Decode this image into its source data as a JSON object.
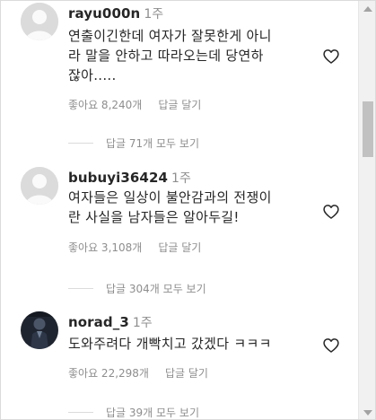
{
  "comments": [
    {
      "username": "rayu000n",
      "time": "1주",
      "text": "연출이긴한데 여자가 잘못한게 아니\n라 말을 안하고 따라오는데 당연하\n잖아.....",
      "likes": "좋아요 8,240개",
      "reply_label": "답글 달기",
      "view_replies": "답글 71개 모두 보기",
      "avatar": "default-avatar"
    },
    {
      "username": "bubuyi36424",
      "time": "1주",
      "text": "여자들은 일상이 불안감과의 전쟁이\n란 사실을 남자들은 알아두길!",
      "likes": "좋아요 3,108개",
      "reply_label": "답글 달기",
      "view_replies": "답글 304개 모두 보기",
      "avatar": "default-avatar"
    },
    {
      "username": "norad_3",
      "time": "1주",
      "text": "도와주려다 개빡치고 갔겠다 ㅋㅋㅋ",
      "likes": "좋아요 22,298개",
      "reply_label": "답글 달기",
      "view_replies": "답글 39개 모두 보기",
      "avatar": "photo-avatar"
    }
  ],
  "icons": {
    "like": "heart-outline-icon"
  },
  "colors": {
    "text": "#262626",
    "secondary": "#8e8e8e",
    "avatar_placeholder": "#dbdbdb"
  }
}
